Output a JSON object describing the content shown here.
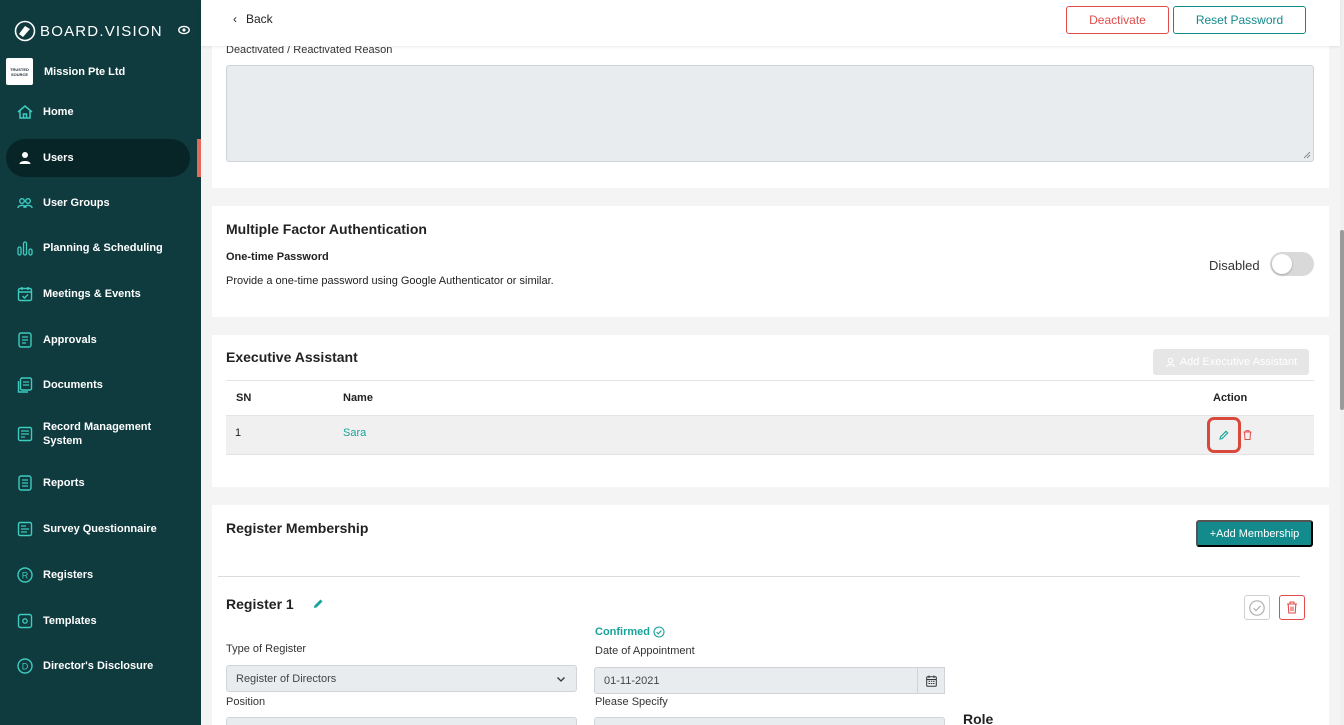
{
  "brand": {
    "logo_text": "BOARD.VISION"
  },
  "org": {
    "name": "Mission Pte Ltd",
    "logo_text": "TRUSTED SOURCE"
  },
  "sidebar": {
    "items": [
      {
        "label": "Home",
        "icon": "home-icon"
      },
      {
        "label": "Users",
        "icon": "user-icon",
        "active": true
      },
      {
        "label": "User Groups",
        "icon": "users-group-icon"
      },
      {
        "label": "Planning & Scheduling",
        "icon": "bars-icon"
      },
      {
        "label": "Meetings & Events",
        "icon": "calendar-icon"
      },
      {
        "label": "Approvals",
        "icon": "approval-doc-icon"
      },
      {
        "label": "Documents",
        "icon": "documents-icon"
      },
      {
        "label": "Record Management System",
        "icon": "record-icon"
      },
      {
        "label": "Reports",
        "icon": "report-icon"
      },
      {
        "label": "Survey Questionnaire",
        "icon": "survey-icon"
      },
      {
        "label": "Registers",
        "icon": "registers-icon"
      },
      {
        "label": "Templates",
        "icon": "templates-icon"
      },
      {
        "label": "Director's Disclosure",
        "icon": "disclosure-icon"
      }
    ]
  },
  "header": {
    "back_label": "Back",
    "deactivate_label": "Deactivate",
    "reset_password_label": "Reset Password"
  },
  "reason": {
    "label": "Deactivated / Reactivated Reason",
    "value": ""
  },
  "mfa": {
    "title": "Multiple Factor Authentication",
    "otp_title": "One-time Password",
    "otp_desc": "Provide a one-time password using Google Authenticator or similar.",
    "status_label": "Disabled",
    "enabled": false
  },
  "executive_assistant": {
    "title": "Executive Assistant",
    "add_label": "Add Executive Assistant",
    "columns": {
      "sn": "SN",
      "name": "Name",
      "action": "Action"
    },
    "rows": [
      {
        "sn": "1",
        "name": "Sara"
      }
    ]
  },
  "membership": {
    "title": "Register Membership",
    "add_label": "+Add Membership",
    "register": {
      "title": "Register 1",
      "status": "Confirmed",
      "type_label": "Type of Register",
      "type_value": "Register of Directors",
      "position_label": "Position",
      "doa_label": "Date of Appointment",
      "doa_value": "01-11-2021",
      "specify_label": "Please Specify",
      "role_label": "Role"
    }
  },
  "colors": {
    "sidebar_bg": "#0f3a3e",
    "accent": "#138a8c",
    "danger": "#e34b4b",
    "confirmed": "#17a39b"
  }
}
